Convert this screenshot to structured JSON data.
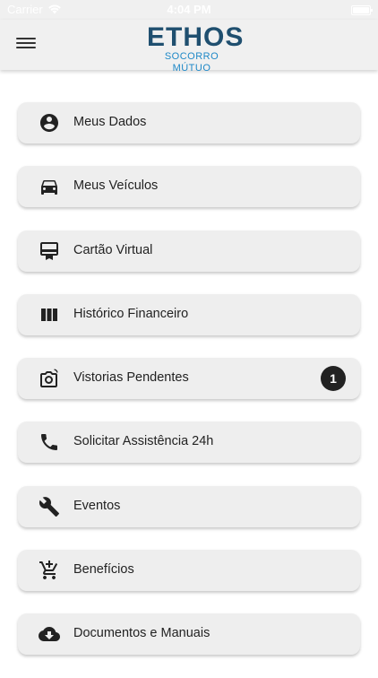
{
  "status_bar": {
    "carrier": "Carrier",
    "time": "4:04 PM"
  },
  "header": {
    "logo_title": "ETHOS",
    "logo_subtitle": "SOCORRO MÚTUO"
  },
  "menu": {
    "items": [
      {
        "label": "Meus Dados",
        "icon": "account-circle-icon"
      },
      {
        "label": "Meus Veículos",
        "icon": "car-icon"
      },
      {
        "label": "Cartão Virtual",
        "icon": "card-icon"
      },
      {
        "label": "Histórico Financeiro",
        "icon": "columns-icon"
      },
      {
        "label": "Vistorias Pendentes",
        "icon": "camera-icon",
        "badge": "1"
      },
      {
        "label": "Solicitar Assistência 24h",
        "icon": "phone-icon"
      },
      {
        "label": "Eventos",
        "icon": "wrench-icon"
      },
      {
        "label": "Benefícios",
        "icon": "cart-add-icon"
      },
      {
        "label": "Documentos e Manuais",
        "icon": "cloud-download-icon"
      }
    ]
  },
  "colors": {
    "logo_primary": "#1f4f6f",
    "logo_secondary": "#1e88c7",
    "badge_bg": "#222222"
  }
}
